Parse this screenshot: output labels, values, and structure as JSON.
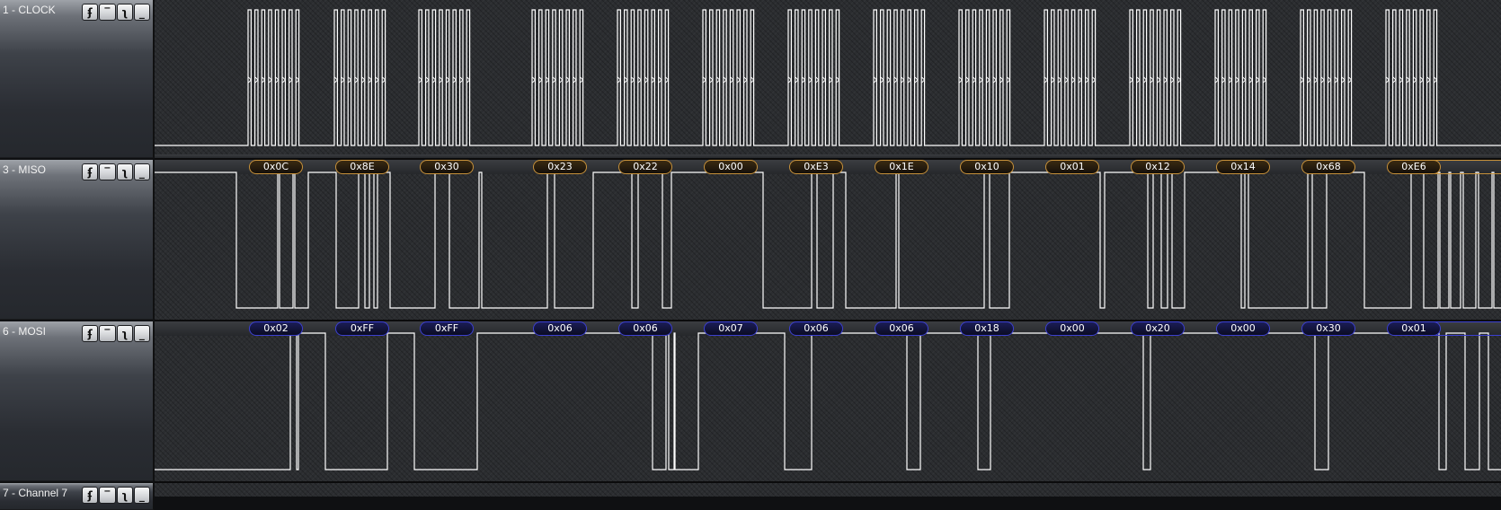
{
  "channels": [
    {
      "id": "clock",
      "label": "1 - CLOCK"
    },
    {
      "id": "miso",
      "label": "3 - MISO"
    },
    {
      "id": "mosi",
      "label": "6 - MOSI"
    },
    {
      "id": "ch7",
      "label": "7 - Channel 7"
    }
  ],
  "trigger_buttons": {
    "rising": "ʄ",
    "high": "‾",
    "falling": "ʅ",
    "low": "_"
  },
  "decoded": {
    "miso": [
      "0x0C",
      "0x8E",
      "0x30",
      "0x23",
      "0x22",
      "0x00",
      "0xE3",
      "0x1E",
      "0x10",
      "0x01",
      "0x12",
      "0x14",
      "0x68",
      "0xE6"
    ],
    "mosi": [
      "0x02",
      "0xFF",
      "0xFF",
      "0x06",
      "0x06",
      "0x07",
      "0x06",
      "0x06",
      "0x18",
      "0x00",
      "0x20",
      "0x00",
      "0x30",
      "0x01"
    ]
  },
  "colors": {
    "miso_accent": "#c7913a",
    "mosi_accent": "#3b3fd1",
    "trace": "#ffffff",
    "background": "#2b2d30"
  }
}
